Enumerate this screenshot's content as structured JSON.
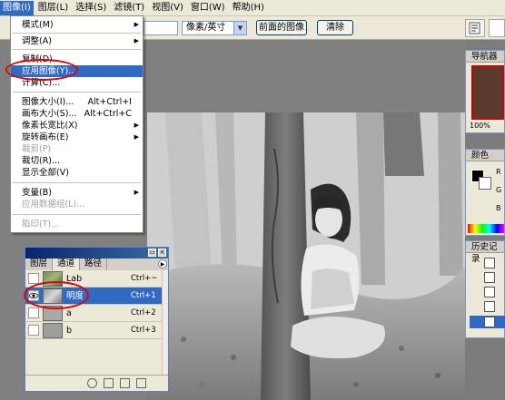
{
  "menubar": {
    "items": [
      "图像(I)",
      "图层(L)",
      "选择(S)",
      "滤镜(T)",
      "视图(V)",
      "窗口(W)",
      "帮助(H)"
    ]
  },
  "options": {
    "unit_select": "像素/英寸",
    "front_image_button": "前面的图像",
    "clear_button": "清除"
  },
  "image_menu": {
    "items": [
      {
        "label": "模式(M)",
        "shortcut": "",
        "submenu": true,
        "disabled": false
      },
      {
        "label": "调整(A)",
        "shortcut": "",
        "submenu": true,
        "disabled": false
      },
      {
        "label": "复制(D)...",
        "shortcut": "",
        "submenu": false,
        "disabled": false
      },
      {
        "label": "应用图像(Y)...",
        "shortcut": "",
        "submenu": false,
        "disabled": false
      },
      {
        "label": "计算(C)...",
        "shortcut": "",
        "submenu": false,
        "disabled": false
      },
      {
        "label": "图像大小(I)...",
        "shortcut": "Alt+Ctrl+I",
        "submenu": false,
        "disabled": false
      },
      {
        "label": "画布大小(S)...",
        "shortcut": "Alt+Ctrl+C",
        "submenu": false,
        "disabled": false
      },
      {
        "label": "像素长宽比(X)",
        "shortcut": "",
        "submenu": true,
        "disabled": false
      },
      {
        "label": "旋转画布(E)",
        "shortcut": "",
        "submenu": true,
        "disabled": false
      },
      {
        "label": "裁剪(P)",
        "shortcut": "",
        "submenu": false,
        "disabled": true
      },
      {
        "label": "裁切(R)...",
        "shortcut": "",
        "submenu": false,
        "disabled": false
      },
      {
        "label": "显示全部(V)",
        "shortcut": "",
        "submenu": false,
        "disabled": false
      },
      {
        "label": "变量(B)",
        "shortcut": "",
        "submenu": true,
        "disabled": false
      },
      {
        "label": "应用数据组(L)...",
        "shortcut": "",
        "submenu": false,
        "disabled": true
      },
      {
        "label": "陷印(T)...",
        "shortcut": "",
        "submenu": false,
        "disabled": true
      }
    ],
    "highlighted": "应用图像(Y)..."
  },
  "channels_panel": {
    "tabs": [
      "图层",
      "通道",
      "路径"
    ],
    "active_tab": "通道",
    "rows": [
      {
        "name": "Lab",
        "shortcut": "Ctrl+~",
        "selected": false,
        "visible": false
      },
      {
        "name": "明度",
        "shortcut": "Ctrl+1",
        "selected": true,
        "visible": true
      },
      {
        "name": "a",
        "shortcut": "Ctrl+2",
        "selected": false,
        "visible": false
      },
      {
        "name": "b",
        "shortcut": "Ctrl+3",
        "selected": false,
        "visible": false
      }
    ]
  },
  "right_panels": {
    "navigator": {
      "title": "导航器",
      "zoom": "100%"
    },
    "color": {
      "title": "颜色",
      "channels": [
        "R",
        "G",
        "B"
      ]
    },
    "history": {
      "title": "历史记录"
    }
  },
  "colors": {
    "highlight": "#316ac5",
    "menubar_bg": "#ece9d8",
    "annotation_red": "#e00000"
  }
}
